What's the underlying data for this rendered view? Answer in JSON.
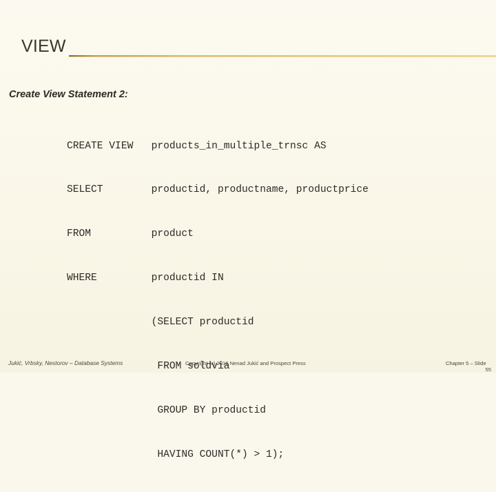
{
  "slide": {
    "title": "VIEW",
    "subtitle": "Create View Statement 2:",
    "code_lines": [
      "CREATE VIEW   products_in_multiple_trnsc AS",
      "SELECT        productid, productname, productprice",
      "FROM          product",
      "WHERE         productid IN",
      "              (SELECT productid",
      "               FROM soldvia",
      "               GROUP BY productid",
      "               HAVING COUNT(*) > 1);"
    ],
    "footer": {
      "left": "Jukić, Vrbsky, Nestorov – Database Systems",
      "center": "Copyright (c) 2016 Nenad Jukić and Prospect Press",
      "right": "Chapter 5 – Slide",
      "slide_number": "55"
    },
    "colors": {
      "background": "#faf8ec",
      "rule_gold": "#e2b851",
      "title_text": "#3a352c",
      "body_text": "#2b2a26",
      "footer_text": "#4a463c"
    }
  }
}
